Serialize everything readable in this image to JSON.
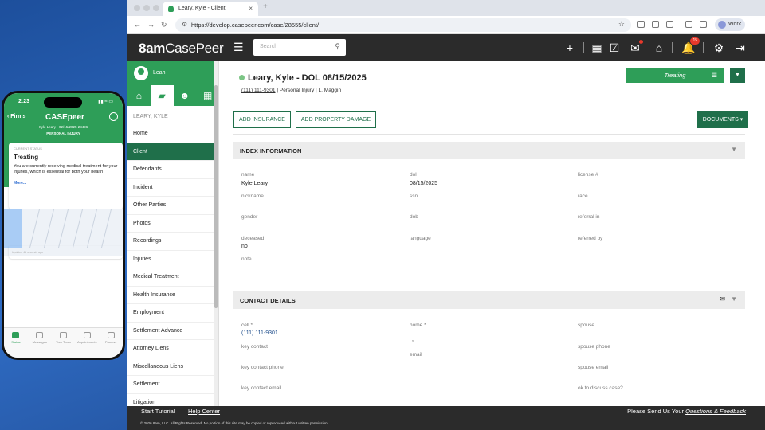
{
  "phone": {
    "time": "2:23",
    "status_icons": "▮▮ ≈ ▭",
    "back_label": "Firms",
    "brand": "CASEpeer",
    "case_line": "Kyle Leary - 02/15/2025 28496",
    "case_type": "PERSONAL INJURY",
    "card_label": "CURRENT STATUS",
    "card_title": "Treating",
    "card_text": "You are currently receiving medical treatment for your injuries, which is essential for both your health",
    "card_more": "More...",
    "updated": "Updated 41 seconds ago",
    "tabs": [
      {
        "label": "Status"
      },
      {
        "label": "Messages"
      },
      {
        "label": "Your Team"
      },
      {
        "label": "Appointments"
      },
      {
        "label": "Process"
      }
    ]
  },
  "browser": {
    "tab_title": "Leary, Kyle - Client",
    "url": "https://develop.casepeer.com/case/28555/client/",
    "profile": "Work"
  },
  "header": {
    "logo_bold": "8am",
    "logo_rest": "CasePeer",
    "search_placeholder": "Search",
    "notifications_count": "15"
  },
  "sidebar": {
    "user": "Leah",
    "client_name": "LEARY, KYLE",
    "items": [
      {
        "label": "Home"
      },
      {
        "label": "Client"
      },
      {
        "label": "Defendants"
      },
      {
        "label": "Incident"
      },
      {
        "label": "Other Parties"
      },
      {
        "label": "Photos"
      },
      {
        "label": "Recordings"
      },
      {
        "label": "Injuries"
      },
      {
        "label": "Medical Treatment"
      },
      {
        "label": "Health Insurance"
      },
      {
        "label": "Employment"
      },
      {
        "label": "Settlement Advance"
      },
      {
        "label": "Attorney Liens"
      },
      {
        "label": "Miscellaneous Liens"
      },
      {
        "label": "Settlement"
      },
      {
        "label": "Litigation"
      }
    ]
  },
  "case": {
    "title": "Leary, Kyle - DOL 08/15/2025",
    "phone": "(111) 111-9301",
    "sep1": "|",
    "type": "Personal Injury",
    "sep2": "|",
    "attorney": "L. Maggin",
    "status": "Treating",
    "status_color": "#2e9e58"
  },
  "actions": {
    "add_insurance": "ADD INSURANCE",
    "add_property_damage": "ADD PROPERTY DAMAGE",
    "documents": "DOCUMENTS ▾"
  },
  "index_section": {
    "title": "INDEX INFORMATION",
    "fields": {
      "name_label": "name",
      "name_value": "Kyle Leary",
      "dol_label": "dol",
      "dol_value": "08/15/2025",
      "license_label": "license #",
      "nickname_label": "nickname",
      "ssn_label": "ssn",
      "race_label": "race",
      "gender_label": "gender",
      "dob_label": "dob",
      "referral_label": "referral in",
      "deceased_label": "deceased",
      "deceased_value": "no",
      "language_label": "language",
      "referred_by_label": "referred by",
      "note_label": "note"
    }
  },
  "contact_section": {
    "title": "CONTACT DETAILS",
    "fields": {
      "cell_label": "cell *",
      "cell_value": "(111) 111-9301",
      "home_label": "home *",
      "home_value": ",",
      "spouse_label": "spouse",
      "key_contact_label": "key contact",
      "email_label": "email",
      "spouse_phone_label": "spouse phone",
      "key_contact_phone_label": "key contact phone",
      "spouse_email_label": "spouse email",
      "key_contact_email_label": "key contact email",
      "ok_discuss_label": "ok to discuss case?"
    }
  },
  "footer": {
    "start_tutorial": "Start Tutorial",
    "help_center": "Help Center",
    "feedback_prefix": "Please Send Us Your ",
    "feedback_link": "Questions & Feedback",
    "copyright": "© 2026 8am, LLC. All Rights Reserved. No portion of this site may be copied or reproduced without written permission."
  }
}
